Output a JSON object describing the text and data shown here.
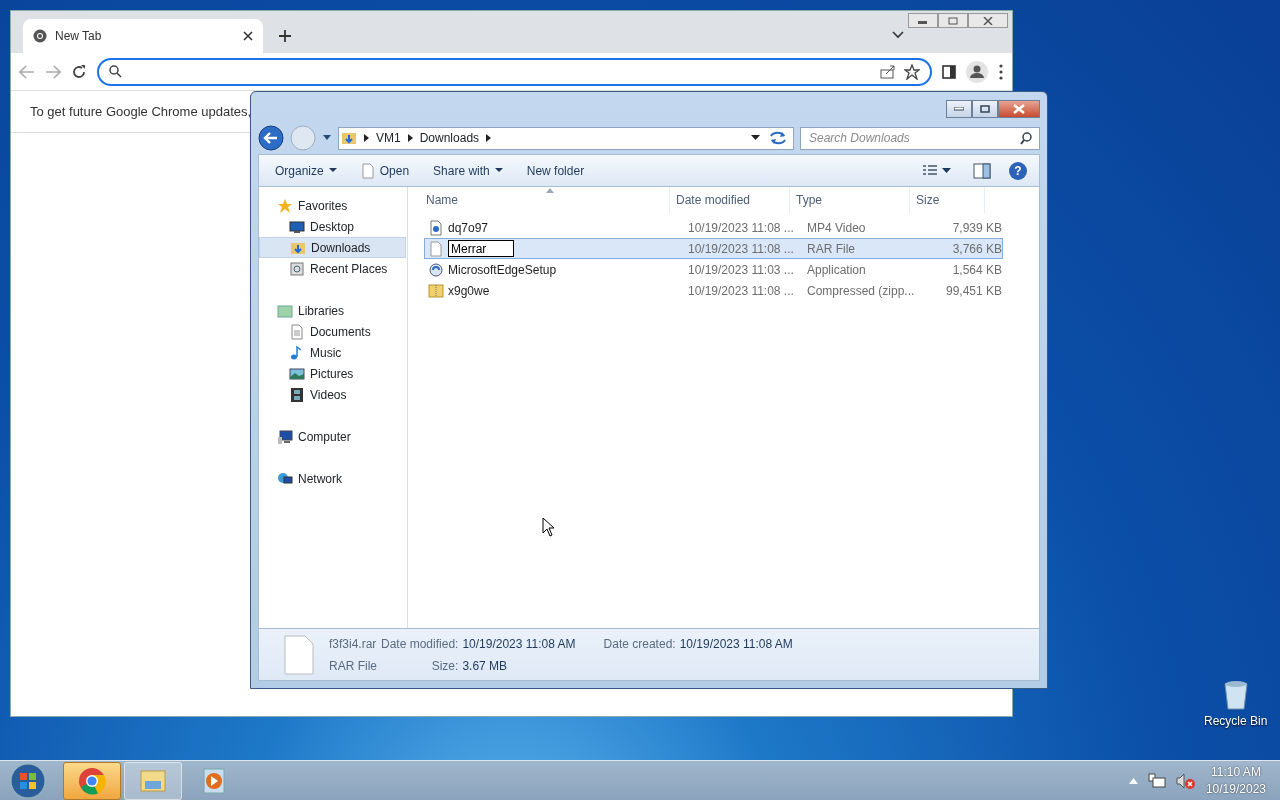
{
  "desktop_icons": [
    {
      "label": "Recycle Bin"
    }
  ],
  "chrome": {
    "tab_title": "New Tab",
    "infobar_text": "To get future Google Chrome updates,"
  },
  "explorer": {
    "breadcrumb": [
      "VM1",
      "Downloads"
    ],
    "search": {
      "placeholder": "Search Downloads"
    },
    "toolbar": [
      {
        "label": "Organize",
        "kind": "menu"
      },
      {
        "label": "Open",
        "kind": "file"
      },
      {
        "label": "Share with",
        "kind": "menu"
      },
      {
        "label": "New folder",
        "kind": "plain"
      }
    ],
    "nav": [
      {
        "label": "Favorites",
        "kind": "star",
        "selected": false,
        "children": [
          {
            "label": "Desktop",
            "kind": "desktop",
            "selected": false
          },
          {
            "label": "Downloads",
            "kind": "downloads",
            "selected": true
          },
          {
            "label": "Recent Places",
            "kind": "recent",
            "selected": false
          }
        ]
      },
      {
        "label": "Libraries",
        "kind": "library",
        "selected": false,
        "children": [
          {
            "label": "Documents",
            "kind": "doc",
            "selected": false
          },
          {
            "label": "Music",
            "kind": "music",
            "selected": false
          },
          {
            "label": "Pictures",
            "kind": "pictures",
            "selected": false
          },
          {
            "label": "Videos",
            "kind": "videos",
            "selected": false
          }
        ]
      },
      {
        "label": "Computer",
        "kind": "computer",
        "selected": false
      },
      {
        "label": "Network",
        "kind": "network",
        "selected": false
      }
    ],
    "help_button": {
      "label": "?"
    },
    "columns": [
      "Name",
      "Date modified",
      "Type",
      "Size"
    ],
    "rows": [
      {
        "name": "dq7o97",
        "kind": "video",
        "date": "10/19/2023 11:08 ...",
        "type": "MP4 Video",
        "size": "7,939 KB",
        "selected": false,
        "renaming": false
      },
      {
        "name": "Merrar",
        "kind": "file",
        "date": "10/19/2023 11:08 ...",
        "type": "RAR File",
        "size": "3,766 KB",
        "selected": true,
        "renaming": true
      },
      {
        "name": "MicrosoftEdgeSetup",
        "kind": "app",
        "date": "10/19/2023 11:03 ...",
        "type": "Application",
        "size": "1,564 KB",
        "selected": false,
        "renaming": false
      },
      {
        "name": "x9g0we",
        "kind": "zip",
        "date": "10/19/2023 11:08 ...",
        "type": "Compressed (zipp...",
        "size": "99,451 KB",
        "selected": false,
        "renaming": false
      }
    ],
    "details": {
      "filename": "f3f3i4.rar",
      "filetype": "RAR File",
      "fields": [
        {
          "label": "Date modified:",
          "value": "10/19/2023 11:08 AM"
        },
        {
          "label": "Size:",
          "value": "3.67 MB"
        },
        {
          "label": "Date created:",
          "value": "10/19/2023 11:08 AM"
        }
      ]
    }
  },
  "taskbar": {
    "apps": [
      {
        "kind": "chrome",
        "active": true
      },
      {
        "kind": "explorer",
        "active": false
      },
      {
        "kind": "media",
        "active": false
      }
    ],
    "time": "11:10 AM",
    "date": "10/19/2023"
  }
}
